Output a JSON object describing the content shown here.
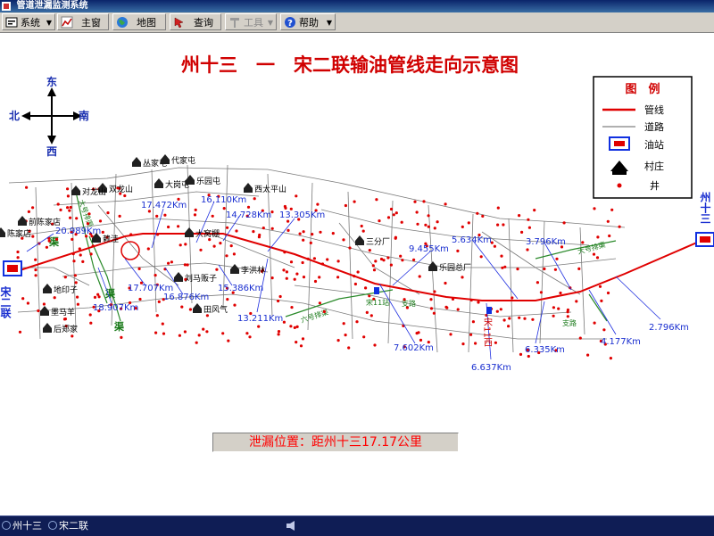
{
  "window": {
    "title": "管道泄漏监测系统"
  },
  "toolbar": {
    "system": "系统",
    "main": "主窗",
    "map": "地图",
    "query": "查询",
    "tools": "工具",
    "help": "帮助"
  },
  "map": {
    "title": "州十三　一　宋二联输油管线走向示意图",
    "compass": {
      "north": "北",
      "south": "南",
      "east": "东",
      "west": "西"
    },
    "legend": {
      "title": "图　例",
      "items": [
        {
          "icon": "pipeline-line",
          "label": "管线",
          "color": "#e00000"
        },
        {
          "icon": "road-line",
          "label": "道路",
          "color": "#606060"
        },
        {
          "icon": "oil-station-icon",
          "label": "油站",
          "color": "#1030e0"
        },
        {
          "icon": "village-icon",
          "label": "村庄",
          "color": "#000000"
        },
        {
          "icon": "well-dot",
          "label": "井",
          "color": "#e00000"
        }
      ]
    },
    "endpoints": {
      "right_station": "州十三",
      "left_station": "宋二联"
    },
    "villages": [
      "丛家屯",
      "代家屯",
      "双龙山",
      "大岗屯",
      "乐园屯",
      "西太平山",
      "前陈家店",
      "陈家店",
      "对龙山",
      "赖洼",
      "大窝棚",
      "李洪林",
      "刘马贩子",
      "田风气",
      "地印子",
      "墨马羊",
      "后郑家",
      "三分厂",
      "乐园总厂"
    ],
    "stations": [
      "宋11站",
      "宋11西"
    ],
    "channel_labels": [
      "大号排渠",
      "六号排渠",
      "支路",
      "支路",
      "渠",
      "渠",
      "渠",
      "大号排渠"
    ],
    "distances": [
      "20.989Km",
      "17.472Km",
      "16.110Km",
      "14.728Km",
      "13.305Km",
      "17.707Km",
      "16.876Km",
      "15.386Km",
      "13.211Km",
      "18.907Km",
      "9.455Km",
      "5.634Km",
      "3.796Km",
      "7.602Km",
      "6.637Km",
      "6.335Km",
      "4.177Km",
      "2.796Km"
    ]
  },
  "leak": {
    "text": "泄漏位置：距州十三17.17公里"
  },
  "statusbar": {
    "tabs": [
      "州十三",
      "宋二联"
    ]
  }
}
